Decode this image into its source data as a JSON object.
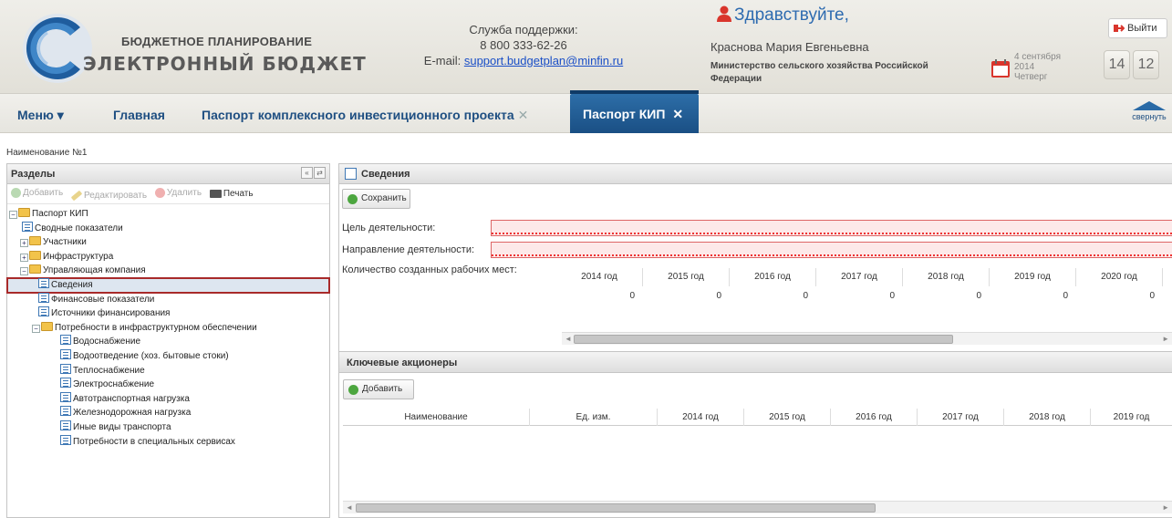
{
  "header": {
    "brand_line1": "БЮДЖЕТНОЕ ПЛАНИРОВАНИЕ",
    "brand_line2": "ЭЛЕКТРОННЫЙ БЮДЖЕТ",
    "support_title": "Служба поддержки:",
    "support_phone": "8 800 333-62-26",
    "support_email_label": "E-mail: ",
    "support_email": "support.budgetplan@minfin.ru",
    "greeting": "Здравствуйте,",
    "user_name": "Краснова Мария Евгеньевна",
    "ministry": "Министерство сельского хозяйства Российской Федерации",
    "date_day": "4 сентября",
    "date_year": "2014",
    "date_weekday": "Четверг",
    "time_hours": "14",
    "time_minutes": "12",
    "logout_label": "Выйти"
  },
  "nav": {
    "menu": "Меню ▾",
    "main": "Главная",
    "tab1": "Паспорт комплексного инвестиционного проекта",
    "tab_active": "Паспорт КИП",
    "close": "✕",
    "collapse": "свернуть"
  },
  "doc_name": "Наименование №1",
  "left": {
    "title": "Разделы",
    "toolbar": {
      "add": "Добавить",
      "edit": "Редактировать",
      "delete": "Удалить",
      "print": "Печать"
    },
    "tree": [
      {
        "label": "Паспорт КИП",
        "type": "folder",
        "level": 0,
        "expander": "−"
      },
      {
        "label": "Сводные показатели",
        "type": "leaf",
        "level": 1
      },
      {
        "label": "Участники",
        "type": "folder",
        "level": 1,
        "expander": "+"
      },
      {
        "label": "Инфраструктура",
        "type": "folder",
        "level": 1,
        "expander": "+"
      },
      {
        "label": "Управляющая компания",
        "type": "folder",
        "level": 1,
        "expander": "−"
      },
      {
        "label": "Сведения",
        "type": "leaf",
        "level": 2,
        "selected": true
      },
      {
        "label": "Финансовые показатели",
        "type": "leaf",
        "level": 2
      },
      {
        "label": "Источники финансирования",
        "type": "leaf",
        "level": 2
      },
      {
        "label": "Потребности в инфраструктурном обеспечении",
        "type": "folder",
        "level": 2,
        "expander": "−"
      },
      {
        "label": "Водоснабжение",
        "type": "leaf",
        "level": 3
      },
      {
        "label": "Водоотведение (хоз. бытовые стоки)",
        "type": "leaf",
        "level": 3
      },
      {
        "label": "Теплоснабжение",
        "type": "leaf",
        "level": 3
      },
      {
        "label": "Электроснабжение",
        "type": "leaf",
        "level": 3
      },
      {
        "label": "Автотранспортная нагрузка",
        "type": "leaf",
        "level": 3
      },
      {
        "label": "Железнодорожная нагрузка",
        "type": "leaf",
        "level": 3
      },
      {
        "label": "Иные виды транспорта",
        "type": "leaf",
        "level": 3
      },
      {
        "label": "Потребности в специальных сервисах",
        "type": "leaf",
        "level": 3
      }
    ]
  },
  "right": {
    "title": "Сведения",
    "save": "Сохранить",
    "goal_label": "Цель деятельности:",
    "direction_label": "Направление деятельности:",
    "jobs_label": "Количество созданных рабочих мест:",
    "years": [
      "2014 год",
      "2015 год",
      "2016 год",
      "2017 год",
      "2018 год",
      "2019 год",
      "2020 год"
    ],
    "jobs_values": [
      "0",
      "0",
      "0",
      "0",
      "0",
      "0",
      "0"
    ],
    "shareholders": {
      "title": "Ключевые акционеры",
      "add": "Добавить",
      "columns": [
        "Наименование",
        "Ед. изм.",
        "2014 год",
        "2015 год",
        "2016 год",
        "2017 год",
        "2018 год",
        "2019 год"
      ]
    }
  }
}
